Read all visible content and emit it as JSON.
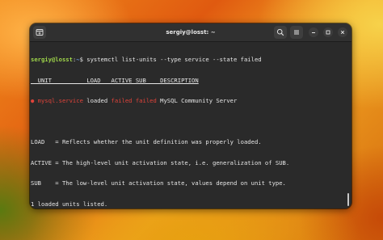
{
  "window": {
    "title": "sergiy@losst: ~"
  },
  "icons": {
    "new_tab": "new-tab-icon",
    "search": "search-icon",
    "menu": "hamburger-menu-icon",
    "minimize": "minimize-icon",
    "maximize": "maximize-icon",
    "close": "close-icon"
  },
  "terminal": {
    "prompt_user": "sergiy@losst",
    "prompt_path": "~",
    "prompt_symbol": "$",
    "command": "systemctl list-units --type service --state failed",
    "header": "  UNIT          LOAD   ACTIVE SUB    DESCRIPTION",
    "row": {
      "bullet": "●",
      "unit": "mysql.service",
      "load": "loaded",
      "active": "failed",
      "sub": "failed",
      "description": "MySQL Community Server"
    },
    "legend": [
      "LOAD   = Reflects whether the unit definition was properly loaded.",
      "ACTIVE = The high-level unit activation state, i.e. generalization of SUB.",
      "SUB    = The low-level unit activation state, values depend on unit type."
    ],
    "summary": "1 loaded units listed."
  },
  "colors": {
    "prompt_user": "#9ed44a",
    "prompt_path": "#6f9fe8",
    "failed": "#e0433a",
    "terminal_bg": "#2a2a2a"
  }
}
